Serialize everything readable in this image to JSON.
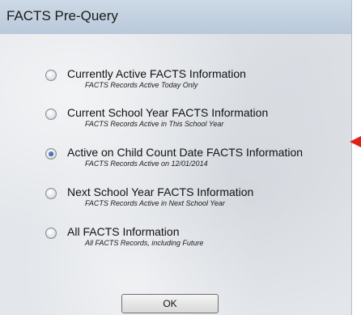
{
  "window": {
    "title": "FACTS Pre-Query"
  },
  "options": [
    {
      "label": "Currently Active FACTS Information",
      "sublabel": "FACTS Records Active Today Only",
      "selected": false
    },
    {
      "label": "Current School Year FACTS Information",
      "sublabel": "FACTS Records Active in This School Year",
      "selected": false
    },
    {
      "label": "Active on Child Count Date FACTS Information",
      "sublabel": "FACTS Records Active on 12/01/2014",
      "selected": true
    },
    {
      "label": "Next School Year FACTS Information",
      "sublabel": "FACTS Records Active in Next School Year",
      "selected": false
    },
    {
      "label": "All FACTS Information",
      "sublabel": "All FACTS Records, including Future",
      "selected": false
    }
  ],
  "buttons": {
    "ok_label": "OK"
  },
  "annotation": {
    "arrow_color": "#e0201a"
  }
}
